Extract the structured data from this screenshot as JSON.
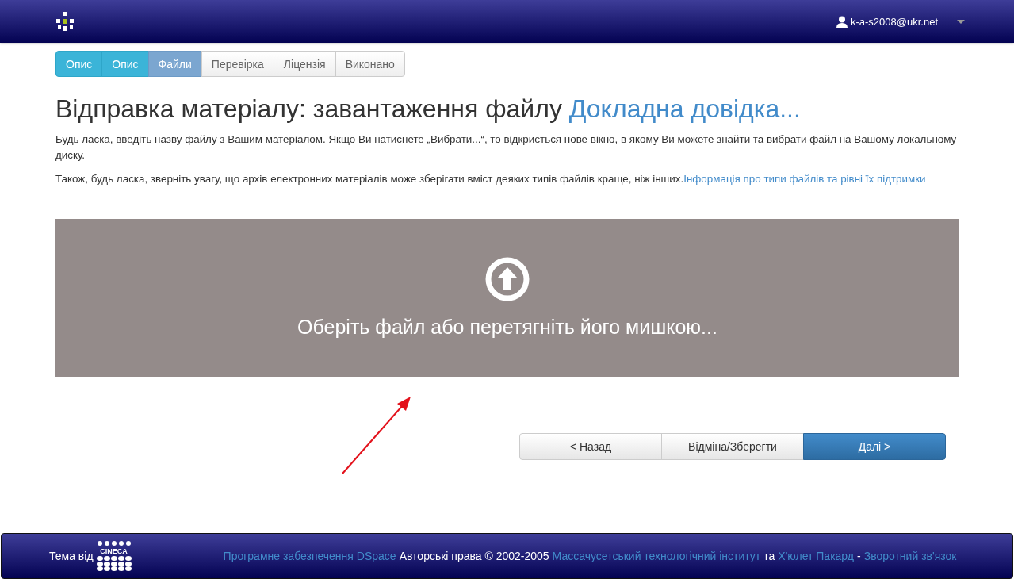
{
  "header": {
    "user": "k-a-s2008@ukr.net"
  },
  "steps": [
    {
      "label": "Опис",
      "done": true,
      "selected": false
    },
    {
      "label": "Опис",
      "done": true,
      "selected": false
    },
    {
      "label": "Файли",
      "done": false,
      "selected": true
    },
    {
      "label": "Перевірка",
      "done": false,
      "selected": false
    },
    {
      "label": "Ліцензія",
      "done": false,
      "selected": false
    },
    {
      "label": "Виконано",
      "done": false,
      "selected": false
    }
  ],
  "title": "Відправка матеріалу: завантаження файлу",
  "help_link": "Докладна довідка...",
  "paragraphs": [
    {
      "text": "Будь ласка, введіть назву файлу з Вашим матеріалом. Якщо Ви натиснете „Вибрати...“, то відкриється нове вікно, в якому Ви можете знайти та вибрати файл на Вашому локальному диску."
    },
    {
      "text": "Також, будь ласка, зверніть увагу, що архів електронних матеріалів може зберігати вміст деяких типів файлів краще, ніж інших.",
      "link": "Інформація про типи файлів та рівні їх підтримки"
    }
  ],
  "dropzone": {
    "label": "Оберіть файл або перетягніть його мишкою..."
  },
  "buttons": [
    {
      "label": "< Назад",
      "primary": false
    },
    {
      "label": "Відміна/Зберегти",
      "primary": false
    },
    {
      "label": "Далі >",
      "primary": true
    }
  ],
  "footer": {
    "theme_by": "Тема від",
    "logo": "CINECA",
    "segments": [
      {
        "text": "Програмне забезпечення DSpace",
        "kind": "link"
      },
      {
        "text": "Авторські права © 2002-2005",
        "kind": "text"
      },
      {
        "text": "Массачусетський технологічний інститут",
        "kind": "link"
      },
      {
        "text": "та",
        "kind": "text"
      },
      {
        "text": "Х'юлет Пакард",
        "kind": "link"
      },
      {
        "text": "-",
        "kind": "text"
      },
      {
        "text": "Зворотний зв'язок",
        "kind": "link"
      }
    ]
  }
}
